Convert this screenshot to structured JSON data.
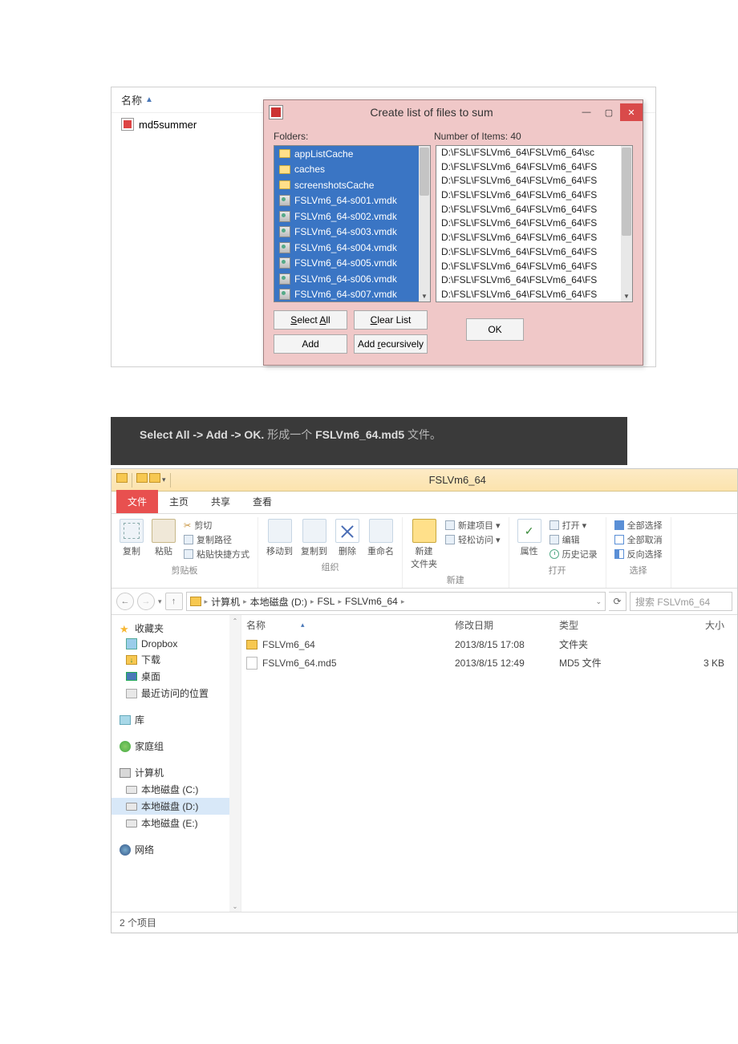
{
  "behind": {
    "col_name": "名称",
    "item": "md5summer"
  },
  "dialog": {
    "title": "Create list of files to sum",
    "label_folders": "Folders:",
    "label_num": "Number of Items: 40",
    "folders": [
      {
        "t": "folder",
        "n": "appListCache"
      },
      {
        "t": "folder",
        "n": "caches"
      },
      {
        "t": "folder",
        "n": "screenshotsCache"
      },
      {
        "t": "vmdk",
        "n": "FSLVm6_64-s001.vmdk"
      },
      {
        "t": "vmdk",
        "n": "FSLVm6_64-s002.vmdk"
      },
      {
        "t": "vmdk",
        "n": "FSLVm6_64-s003.vmdk"
      },
      {
        "t": "vmdk",
        "n": "FSLVm6_64-s004.vmdk"
      },
      {
        "t": "vmdk",
        "n": "FSLVm6_64-s005.vmdk"
      },
      {
        "t": "vmdk",
        "n": "FSLVm6_64-s006.vmdk"
      },
      {
        "t": "vmdk",
        "n": "FSLVm6_64-s007.vmdk"
      }
    ],
    "paths": [
      "D:\\FSL\\FSLVm6_64\\FSLVm6_64\\sc",
      "D:\\FSL\\FSLVm6_64\\FSLVm6_64\\FS",
      "D:\\FSL\\FSLVm6_64\\FSLVm6_64\\FS",
      "D:\\FSL\\FSLVm6_64\\FSLVm6_64\\FS",
      "D:\\FSL\\FSLVm6_64\\FSLVm6_64\\FS",
      "D:\\FSL\\FSLVm6_64\\FSLVm6_64\\FS",
      "D:\\FSL\\FSLVm6_64\\FSLVm6_64\\FS",
      "D:\\FSL\\FSLVm6_64\\FSLVm6_64\\FS",
      "D:\\FSL\\FSLVm6_64\\FSLVm6_64\\FS",
      "D:\\FSL\\FSLVm6_64\\FSLVm6_64\\FS",
      "D:\\FSL\\FSLVm6_64\\FSLVm6_64\\FS"
    ],
    "btn_select_all": "Select All",
    "btn_clear": "Clear List",
    "btn_add": "Add",
    "btn_add_rec": "Add recursively",
    "btn_ok": "OK"
  },
  "caption": {
    "b1": "Select All -> Add -> OK.",
    "mid": " 形成一个 ",
    "b2": "FSLVm6_64.md5",
    "tail": " 文件。"
  },
  "explorer": {
    "window_title": "FSLVm6_64",
    "tabs": {
      "file": "文件",
      "home": "主页",
      "share": "共享",
      "view": "查看"
    },
    "ribbon": {
      "cut": "剪切",
      "copypath": "复制路径",
      "pasteshortcut": "粘贴快捷方式",
      "copy": "复制",
      "paste": "粘贴",
      "clipboard": "剪贴板",
      "moveto": "移动到",
      "copyto": "复制到",
      "delete": "删除",
      "rename": "重命名",
      "organize": "组织",
      "newfolder": "新建\n文件夹",
      "newitem": "新建项目 ▾",
      "easyaccess": "轻松访问 ▾",
      "new": "新建",
      "properties": "属性",
      "open": "打开 ▾",
      "edit": "编辑",
      "history": "历史记录",
      "open_grp": "打开",
      "selectall": "全部选择",
      "selectnone": "全部取消",
      "invert": "反向选择",
      "select": "选择"
    },
    "breadcrumb": [
      "计算机",
      "本地磁盘 (D:)",
      "FSL",
      "FSLVm6_64"
    ],
    "search_placeholder": "搜索 FSLVm6_64",
    "nav": {
      "favorites": "收藏夹",
      "dropbox": "Dropbox",
      "downloads": "下载",
      "desktop": "桌面",
      "recent": "最近访问的位置",
      "libraries": "库",
      "homegroup": "家庭组",
      "computer": "计算机",
      "diskC": "本地磁盘 (C:)",
      "diskD": "本地磁盘 (D:)",
      "diskE": "本地磁盘 (E:)",
      "network": "网络"
    },
    "cols": {
      "name": "名称",
      "date": "修改日期",
      "type": "类型",
      "size": "大小"
    },
    "files": [
      {
        "name": "FSLVm6_64",
        "date": "2013/8/15 17:08",
        "type": "文件夹",
        "size": ""
      },
      {
        "name": "FSLVm6_64.md5",
        "date": "2013/8/15 12:49",
        "type": "MD5 文件",
        "size": "3 KB"
      }
    ],
    "status": "2 个项目"
  }
}
